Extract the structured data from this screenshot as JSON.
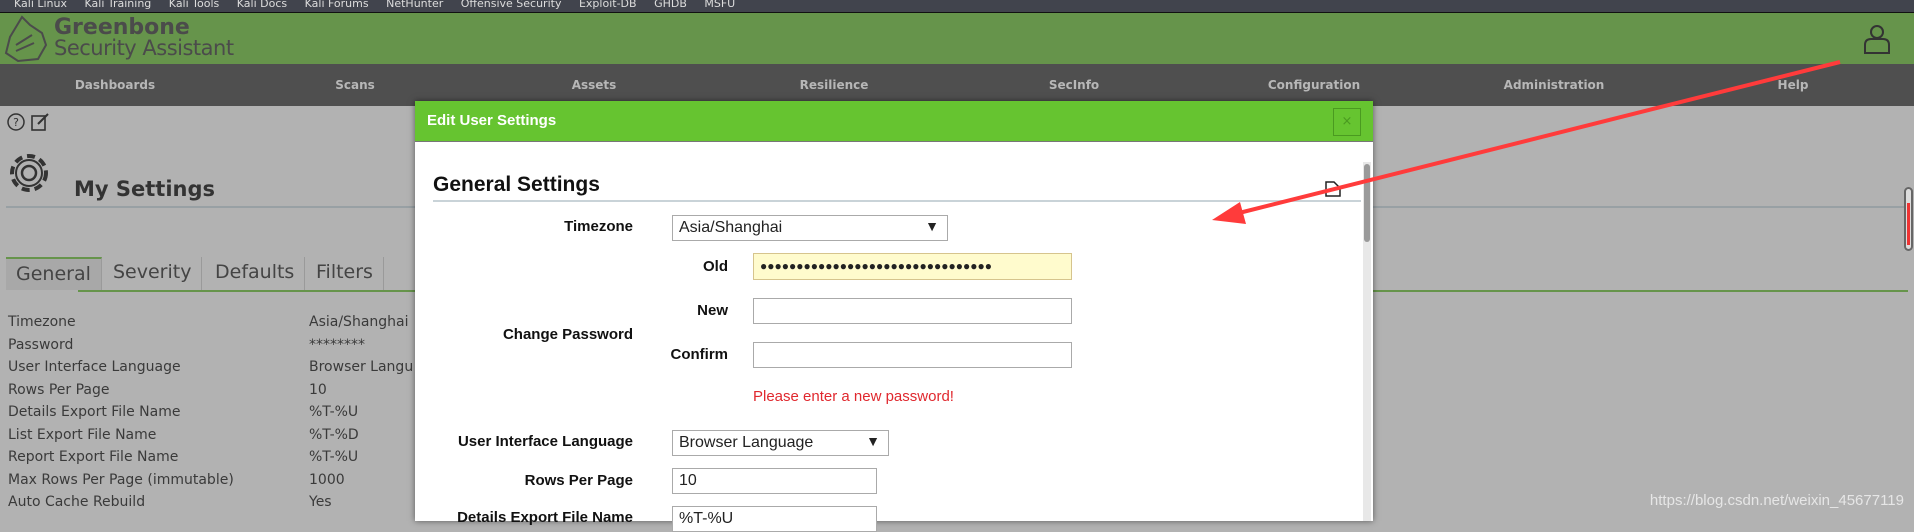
{
  "bookmarks": [
    "Kali Linux",
    "Kali Training",
    "Kali Tools",
    "Kali Docs",
    "Kali Forums",
    "NetHunter",
    "Offensive Security",
    "Exploit-DB",
    "GHDB",
    "MSFU"
  ],
  "brand": {
    "line1": "Greenbone",
    "line2": "Security Assistant"
  },
  "nav": [
    "Dashboards",
    "Scans",
    "Assets",
    "Resilience",
    "SecInfo",
    "Configuration",
    "Administration",
    "Help"
  ],
  "page": {
    "title": "My Settings",
    "tabs": [
      "General",
      "Severity",
      "Defaults",
      "Filters"
    ],
    "rows": [
      [
        "Timezone",
        "Asia/Shanghai"
      ],
      [
        "Password",
        "********"
      ],
      [
        "User Interface Language",
        "Browser Langu"
      ],
      [
        "Rows Per Page",
        "10"
      ],
      [
        "Details Export File Name",
        "%T-%U"
      ],
      [
        "List Export File Name",
        "%T-%D"
      ],
      [
        "Report Export File Name",
        "%T-%U"
      ],
      [
        "Max Rows Per Page (immutable)",
        "1000"
      ],
      [
        "Auto Cache Rebuild",
        "Yes"
      ]
    ]
  },
  "modal": {
    "title": "Edit User Settings",
    "close": "×",
    "section": "General Settings",
    "timezone_label": "Timezone",
    "timezone_value": "Asia/Shanghai",
    "change_password_label": "Change Password",
    "old_label": "Old",
    "old_value": "●●●●●●●●●●●●●●●●●●●●●●●●●●●●●●●●",
    "new_label": "New",
    "confirm_label": "Confirm",
    "error": "Please enter a new password!",
    "ui_lang_label": "User Interface Language",
    "ui_lang_value": "Browser Language",
    "rows_label": "Rows Per Page",
    "rows_value": "10",
    "details_label": "Details Export File Name",
    "details_value": "%T-%U"
  },
  "watermark": "https://blog.csdn.net/weixin_45677119",
  "colors": {
    "header": "#66944b",
    "modal_header": "#66c430",
    "error": "#e0282e",
    "annotation_arrow": "#ff3b3b"
  }
}
